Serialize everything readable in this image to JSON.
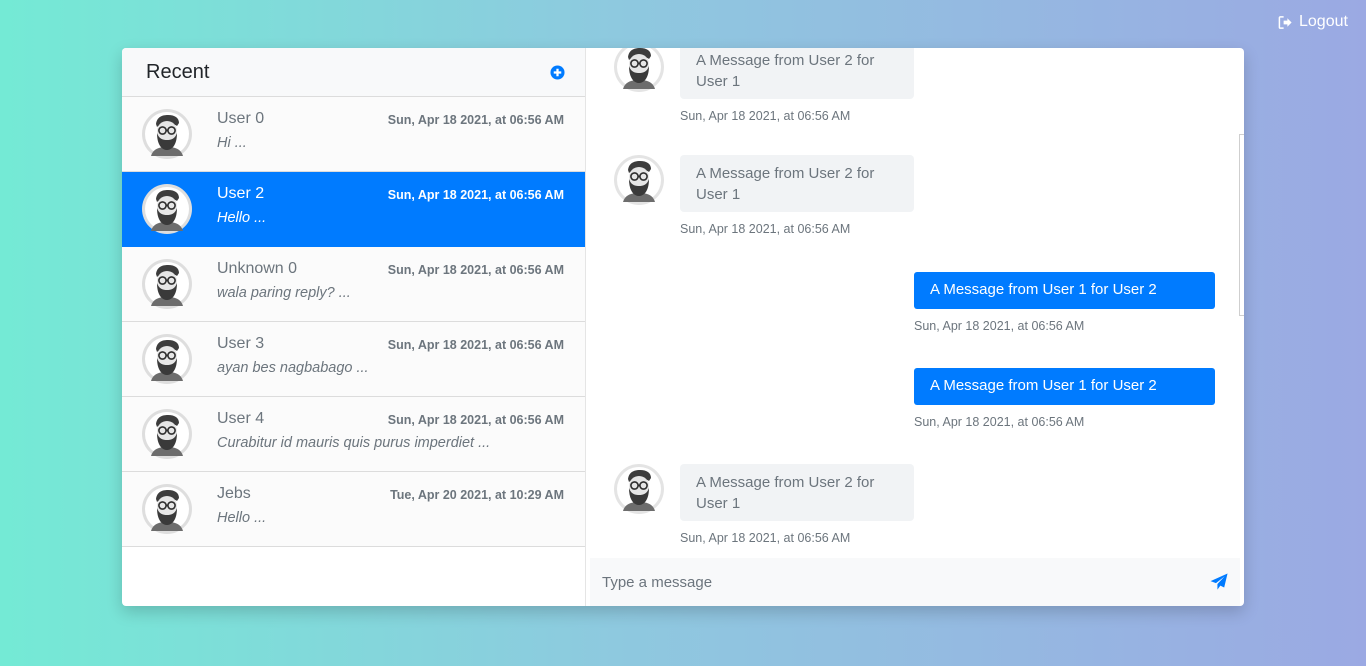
{
  "header": {
    "logout_label": "Logout"
  },
  "sidebar": {
    "title": "Recent",
    "conversations": [
      {
        "name": "User 0",
        "time": "Sun, Apr 18 2021, at 06:56 AM",
        "preview": "Hi ...",
        "active": false
      },
      {
        "name": "User 2",
        "time": "Sun, Apr 18 2021, at 06:56 AM",
        "preview": "Hello ...",
        "active": true
      },
      {
        "name": "Unknown 0",
        "time": "Sun, Apr 18 2021, at 06:56 AM",
        "preview": "wala paring reply? ...",
        "active": false
      },
      {
        "name": "User 3",
        "time": "Sun, Apr 18 2021, at 06:56 AM",
        "preview": "ayan bes nagbabago ...",
        "active": false
      },
      {
        "name": "User 4",
        "time": "Sun, Apr 18 2021, at 06:56 AM",
        "preview": "Curabitur id mauris quis purus imperdiet ...",
        "active": false
      },
      {
        "name": "Jebs",
        "time": "Tue, Apr 20 2021, at 10:29 AM",
        "preview": "Hello ...",
        "active": false
      }
    ]
  },
  "chat": {
    "messages": [
      {
        "direction": "in",
        "text": "A Message from User 2 for User 1",
        "time": "Sun, Apr 18 2021, at 06:56 AM"
      },
      {
        "direction": "in",
        "text": "A Message from User 2 for User 1",
        "time": "Sun, Apr 18 2021, at 06:56 AM"
      },
      {
        "direction": "out",
        "text": "A Message from User 1 for User 2",
        "time": "Sun, Apr 18 2021, at 06:56 AM"
      },
      {
        "direction": "out",
        "text": "A Message from User 1 for User 2",
        "time": "Sun, Apr 18 2021, at 06:56 AM"
      },
      {
        "direction": "in",
        "text": "A Message from User 2 for User 1",
        "time": "Sun, Apr 18 2021, at 06:56 AM"
      }
    ],
    "composer_placeholder": "Type a message"
  },
  "colors": {
    "accent": "#007bff",
    "muted_text": "#6c757d",
    "bubble_in": "#f1f3f5"
  },
  "icons": {
    "logout": "sign-out-icon",
    "add": "plus-circle-icon",
    "send": "paper-plane-icon",
    "avatar": "bearded-man-avatar"
  }
}
